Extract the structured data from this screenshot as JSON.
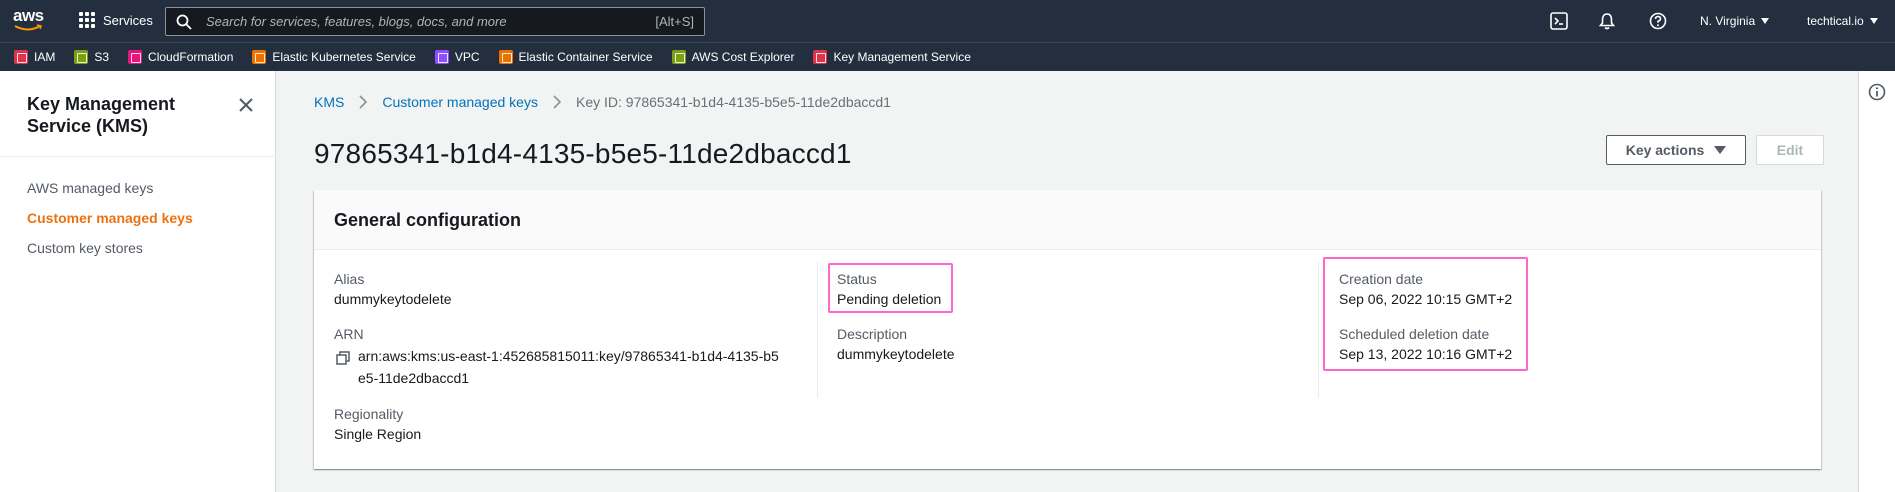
{
  "topnav": {
    "logo_text": "aws",
    "services_label": "Services",
    "search_placeholder": "Search for services, features, blogs, docs, and more",
    "search_shortcut": "[Alt+S]",
    "region_label": "N. Virginia",
    "account_label": "techtical.io",
    "icons": [
      "cloudshell-icon",
      "bell-icon",
      "help-icon"
    ]
  },
  "favorites": [
    {
      "label": "IAM",
      "color": "#dd344c"
    },
    {
      "label": "S3",
      "color": "#7aa116"
    },
    {
      "label": "CloudFormation",
      "color": "#e7157b"
    },
    {
      "label": "Elastic Kubernetes Service",
      "color": "#ed7100"
    },
    {
      "label": "VPC",
      "color": "#8c4fff"
    },
    {
      "label": "Elastic Container Service",
      "color": "#ed7100"
    },
    {
      "label": "AWS Cost Explorer",
      "color": "#7aa116"
    },
    {
      "label": "Key Management Service",
      "color": "#dd344c"
    }
  ],
  "sidebar": {
    "title": "Key Management Service (KMS)",
    "items": [
      {
        "label": "AWS managed keys",
        "active": false
      },
      {
        "label": "Customer managed keys",
        "active": true
      },
      {
        "label": "Custom key stores",
        "active": false
      }
    ]
  },
  "breadcrumb": {
    "root": "KMS",
    "parent": "Customer managed keys",
    "current": "Key ID: 97865341-b1d4-4135-b5e5-11de2dbaccd1"
  },
  "page": {
    "title": "97865341-b1d4-4135-b5e5-11de2dbaccd1",
    "key_actions_label": "Key actions",
    "edit_label": "Edit"
  },
  "general_config": {
    "title": "General configuration",
    "alias_label": "Alias",
    "alias_value": "dummykeytodelete",
    "arn_label": "ARN",
    "arn_line1": "arn:aws:kms:us-east-1:452685815011:key/97865341-b1d4-4135-b5",
    "arn_line2": "e5-11de2dbaccd1",
    "regionality_label": "Regionality",
    "regionality_value": "Single Region",
    "status_label": "Status",
    "status_value": "Pending deletion",
    "description_label": "Description",
    "description_value": "dummykeytodelete",
    "creation_label": "Creation date",
    "creation_value": "Sep 06, 2022 10:15 GMT+2",
    "scheduled_label": "Scheduled deletion date",
    "scheduled_value": "Sep 13, 2022 10:16 GMT+2"
  },
  "colors": {
    "nav_bg": "#232f3e",
    "link": "#0073bb",
    "active": "#ec7211",
    "highlight": "#ff66cc"
  }
}
